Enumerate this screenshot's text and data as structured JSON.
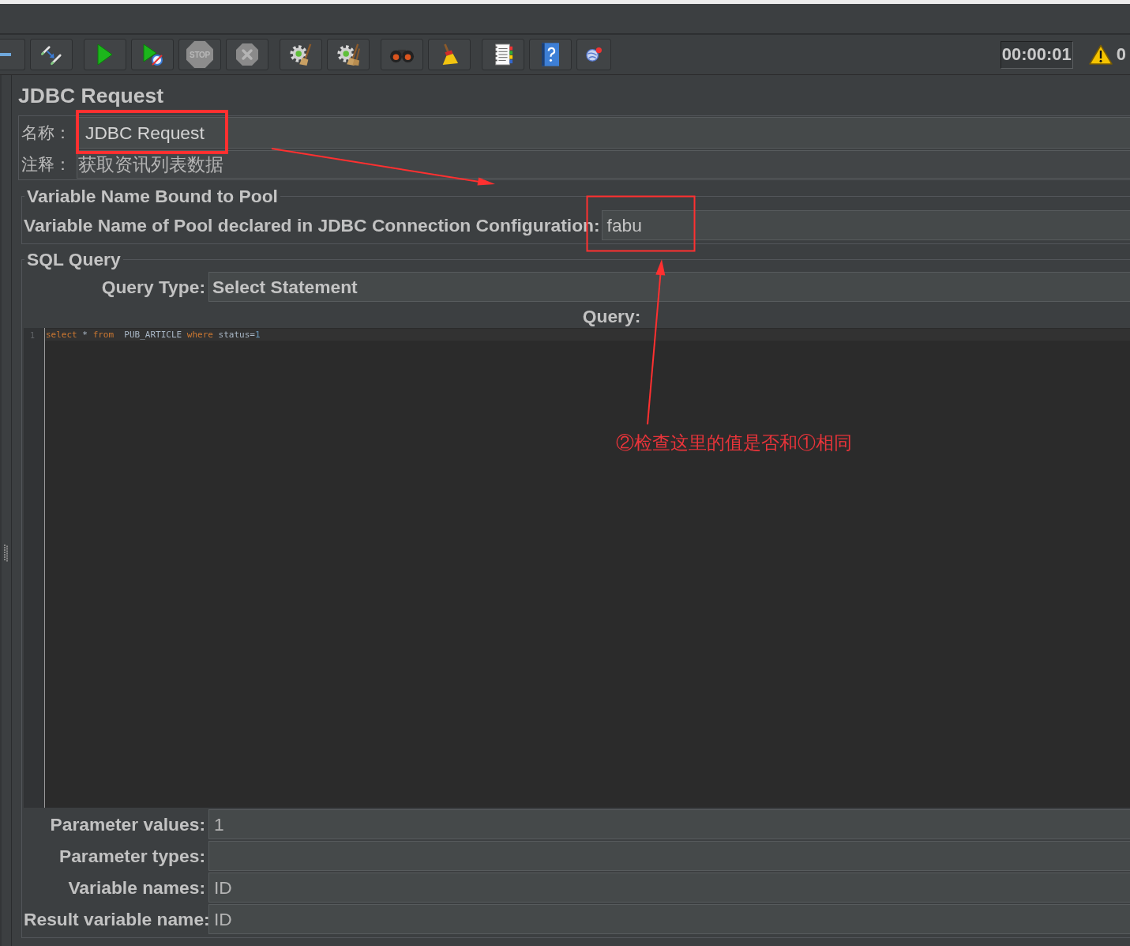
{
  "toolbar": {
    "buttons": [
      {
        "disabled": false
      },
      {
        "disabled": false
      },
      {
        "disabled": false
      },
      {
        "disabled": false
      },
      {
        "label": "STOP",
        "disabled": true
      },
      {
        "disabled": true
      },
      {
        "disabled": false
      },
      {
        "disabled": false
      },
      {
        "disabled": false
      },
      {
        "disabled": false
      },
      {
        "disabled": false
      },
      {
        "disabled": false
      },
      {
        "disabled": false
      }
    ],
    "timer": "00:00:01",
    "warning_count": "0"
  },
  "panel": {
    "title": "JDBC Request",
    "name": {
      "label": "名称：",
      "value": "JDBC Request"
    },
    "comments": {
      "label": "注释：",
      "value": "获取资讯列表数据"
    }
  },
  "pool_section": {
    "legend": "Variable Name Bound to Pool",
    "label": "Variable Name of Pool declared in JDBC Connection Configuration:",
    "value": "fabu"
  },
  "sql_section": {
    "legend": "SQL Query",
    "query_type": {
      "label": "Query Type:",
      "value": "Select Statement"
    },
    "query_label": "Query:",
    "editor": {
      "lines": [
        {
          "number": "1",
          "tokens": [
            {
              "kind": "keyword",
              "text": "select"
            },
            {
              "kind": "plain",
              "text": " * "
            },
            {
              "kind": "keyword",
              "text": "from"
            },
            {
              "kind": "plain",
              "text": "  PUB_ARTICLE "
            },
            {
              "kind": "keyword",
              "text": "where"
            },
            {
              "kind": "plain",
              "text": " status="
            },
            {
              "kind": "number",
              "text": "1"
            }
          ]
        }
      ]
    }
  },
  "parameters": [
    {
      "label": "Parameter values:",
      "value": "1"
    },
    {
      "label": "Parameter types:"
    },
    {
      "label": "Variable names:",
      "value": "ID"
    },
    {
      "label": "Result variable name:",
      "value": "ID"
    }
  ],
  "annotation": {
    "note": "②检查这里的值是否和①相同"
  }
}
